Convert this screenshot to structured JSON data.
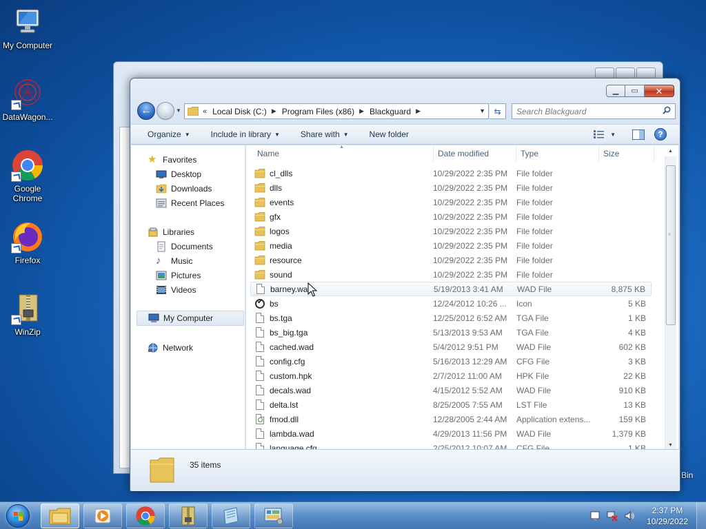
{
  "desktop": {
    "icons": [
      {
        "label": "My Computer"
      },
      {
        "label": "DataWagon..."
      },
      {
        "label": "Google Chrome"
      },
      {
        "label": "Firefox"
      },
      {
        "label": "WinZip"
      }
    ],
    "recycle_bin_partial": "Bin"
  },
  "window": {
    "address": {
      "overflow": "«",
      "crumbs": [
        "Local Disk (C:)",
        "Program Files (x86)",
        "Blackguard"
      ]
    },
    "search_placeholder": "Search Blackguard",
    "toolbar": {
      "organize": "Organize",
      "include_in_library": "Include in library",
      "share_with": "Share with",
      "new_folder": "New folder"
    },
    "navpane": {
      "favorites": "Favorites",
      "desktop": "Desktop",
      "downloads": "Downloads",
      "recent_places": "Recent Places",
      "libraries": "Libraries",
      "documents": "Documents",
      "music": "Music",
      "pictures": "Pictures",
      "videos": "Videos",
      "my_computer": "My Computer",
      "network": "Network"
    },
    "columns": {
      "name": "Name",
      "date_modified": "Date modified",
      "type": "Type",
      "size": "Size"
    },
    "files": [
      {
        "name": "cl_dlls",
        "date": "10/29/2022 2:35 PM",
        "type": "File folder",
        "size": "",
        "icon": "folder"
      },
      {
        "name": "dlls",
        "date": "10/29/2022 2:35 PM",
        "type": "File folder",
        "size": "",
        "icon": "folder"
      },
      {
        "name": "events",
        "date": "10/29/2022 2:35 PM",
        "type": "File folder",
        "size": "",
        "icon": "folder"
      },
      {
        "name": "gfx",
        "date": "10/29/2022 2:35 PM",
        "type": "File folder",
        "size": "",
        "icon": "folder"
      },
      {
        "name": "logos",
        "date": "10/29/2022 2:35 PM",
        "type": "File folder",
        "size": "",
        "icon": "folder"
      },
      {
        "name": "media",
        "date": "10/29/2022 2:35 PM",
        "type": "File folder",
        "size": "",
        "icon": "folder"
      },
      {
        "name": "resource",
        "date": "10/29/2022 2:35 PM",
        "type": "File folder",
        "size": "",
        "icon": "folder"
      },
      {
        "name": "sound",
        "date": "10/29/2022 2:35 PM",
        "type": "File folder",
        "size": "",
        "icon": "folder"
      },
      {
        "name": "barney.wad",
        "date": "5/19/2013 3:41 AM",
        "type": "WAD File",
        "size": "8,875 KB",
        "icon": "file"
      },
      {
        "name": "bs",
        "date": "12/24/2012 10:26 ...",
        "type": "Icon",
        "size": "5 KB",
        "icon": "icon"
      },
      {
        "name": "bs.tga",
        "date": "12/25/2012 6:52 AM",
        "type": "TGA File",
        "size": "1 KB",
        "icon": "file"
      },
      {
        "name": "bs_big.tga",
        "date": "5/13/2013 9:53 AM",
        "type": "TGA File",
        "size": "4 KB",
        "icon": "file"
      },
      {
        "name": "cached.wad",
        "date": "5/4/2012 9:51 PM",
        "type": "WAD File",
        "size": "602 KB",
        "icon": "file"
      },
      {
        "name": "config.cfg",
        "date": "5/16/2013 12:29 AM",
        "type": "CFG File",
        "size": "3 KB",
        "icon": "file"
      },
      {
        "name": "custom.hpk",
        "date": "2/7/2012 11:00 AM",
        "type": "HPK File",
        "size": "22 KB",
        "icon": "file"
      },
      {
        "name": "decals.wad",
        "date": "4/15/2012 5:52 AM",
        "type": "WAD File",
        "size": "910 KB",
        "icon": "file"
      },
      {
        "name": "delta.lst",
        "date": "8/25/2005 7:55 AM",
        "type": "LST File",
        "size": "13 KB",
        "icon": "file"
      },
      {
        "name": "fmod.dll",
        "date": "12/28/2005 2:44 AM",
        "type": "Application extens...",
        "size": "159 KB",
        "icon": "dll"
      },
      {
        "name": "lambda.wad",
        "date": "4/29/2013 11:56 PM",
        "type": "WAD File",
        "size": "1,379 KB",
        "icon": "file"
      },
      {
        "name": "language.cfg",
        "date": "2/25/2012 10:07 AM",
        "type": "CFG File",
        "size": "1 KB",
        "icon": "file"
      }
    ],
    "hover_row_index": 8,
    "item_count": "35 items"
  },
  "taskbar": {
    "time": "2:37 PM",
    "date": "10/29/2022"
  },
  "colors": {
    "desktop": "#1c6cc4",
    "folder": "#e8c35a",
    "close_button": "#c74b2c"
  }
}
